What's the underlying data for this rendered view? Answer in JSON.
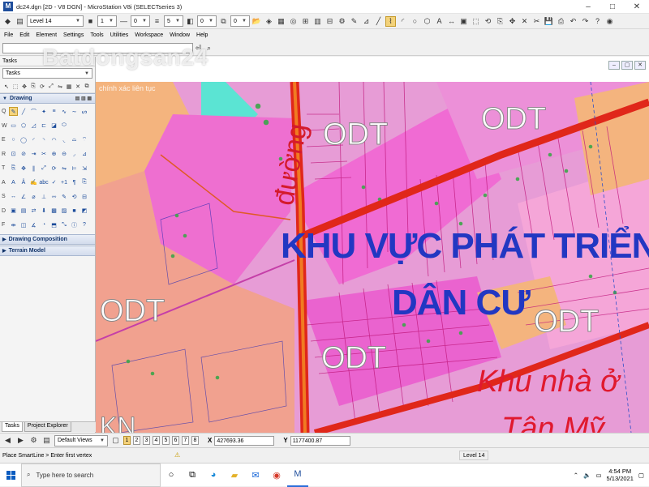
{
  "window": {
    "title": "dc24.dgn [2D - V8 DGN] - MicroStation V8i (SELECTseries 3)",
    "minimize": "–",
    "maximize": "□",
    "close": "✕"
  },
  "toolbar": {
    "level_value": "Level 14",
    "color_value": "1",
    "style_value": "0",
    "weight_value": "5",
    "transparency_value": "0",
    "priority_value": "0"
  },
  "menu": [
    "File",
    "Edit",
    "Element",
    "Settings",
    "Tools",
    "Utilities",
    "Workspace",
    "Window",
    "Help"
  ],
  "watermark": {
    "brand": "Batdongsan24",
    "tagline": "chính xác liên tục"
  },
  "tasks_panel": {
    "header": "Tasks",
    "combo_value": "Tasks",
    "drawing_section": "Drawing",
    "row_letters": [
      "Q",
      "W",
      "E",
      "R",
      "T",
      "A",
      "S",
      "D",
      "F"
    ],
    "drawing_composition": "Drawing Composition",
    "terrain_model": "Terrain Model",
    "tab_tasks": "Tasks",
    "tab_project_explorer": "Project Explorer"
  },
  "map": {
    "odt_labels": [
      "ODT",
      "ODT",
      "ODT",
      "ODT",
      "ODT"
    ],
    "headline_line1": "KHU VỰC PHÁT TRIỂN",
    "headline_line2": "DÂN CƯ",
    "road_label": "đường",
    "khu_nha_o": "Khu nhà ở",
    "bottom_partial": "Tân Mỹ",
    "corner_partial": "KN",
    "colors": {
      "residential_pink": "#e79cd6",
      "magenta_parcels": "#ee48c8",
      "orange_zone": "#f4b47e",
      "road_red": "#e0271a",
      "salmon_zone": "#f1a18f",
      "cyan_water": "#5be4d3",
      "headline_blue": "#2237c2"
    }
  },
  "statusbar": {
    "views_combo": "Default Views",
    "view_numbers": [
      "1",
      "2",
      "3",
      "4",
      "5",
      "6",
      "7",
      "8"
    ],
    "x_label": "X",
    "x_value": "427693.36",
    "y_label": "Y",
    "y_value": "1177400.87",
    "prompt": "Place SmartLine > Enter first vertex",
    "level": "Level 14"
  },
  "taskbar": {
    "search_placeholder": "Type here to search",
    "time": "4:54 PM",
    "date": "5/13/2021"
  }
}
